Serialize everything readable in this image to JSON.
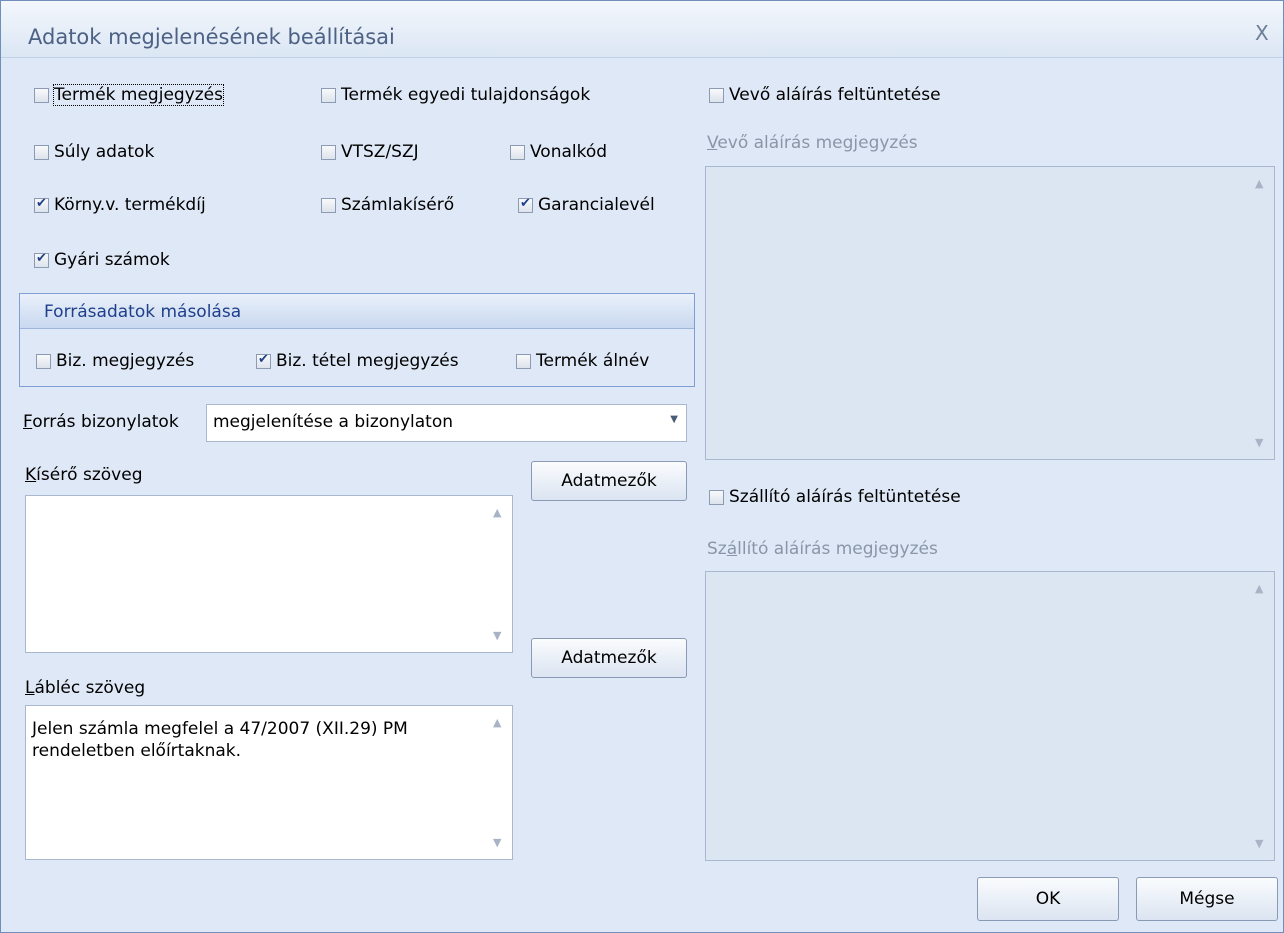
{
  "window": {
    "title": "Adatok megjelenésének beállításai",
    "close_glyph": "X"
  },
  "options": {
    "termek_megjegyzes": {
      "label": "Termék megjegyzés",
      "checked": false
    },
    "termek_egyedi": {
      "label": "Termék egyedi tulajdonságok",
      "checked": false
    },
    "suly_adatok": {
      "label": "Súly adatok",
      "checked": false
    },
    "vtsz": {
      "label": "VTSZ/SZJ",
      "checked": false
    },
    "vonalkod": {
      "label": "Vonalkód",
      "checked": false
    },
    "korny": {
      "label": "Körny.v. termékdíj",
      "checked": true
    },
    "szamlakisero": {
      "label": "Számlakísérő",
      "checked": false
    },
    "garancialevel": {
      "label": "Garancialevél",
      "checked": true
    },
    "gyari_szamok": {
      "label": "Gyári számok",
      "checked": true
    }
  },
  "source_copy": {
    "title": "Forrásadatok másolása",
    "biz_megjegyzes": {
      "label": "Biz. megjegyzés",
      "checked": false
    },
    "biz_tetel": {
      "label": "Biz. tétel megjegyzés",
      "checked": true
    },
    "termek_alnev": {
      "label": "Termék álnév",
      "checked": false
    }
  },
  "source_docs": {
    "label_first": "F",
    "label_rest": "orrás bizonylatok",
    "value": "megjelenítése a bizonylaton"
  },
  "kisero": {
    "label_first": "K",
    "label_rest": "ísérő szöveg",
    "value": "",
    "button": "Adatmezők"
  },
  "lablec": {
    "label_first": "L",
    "label_rest": "ábléc szöveg",
    "line1": "Jelen számla megfelel a 47/2007 (XII.29) PM",
    "line2": "rendeletben előírtaknak.",
    "button": "Adatmezők"
  },
  "vevo": {
    "checkbox": "Vevő aláírás feltüntetése",
    "checked": false,
    "label_first": "V",
    "label_rest": "evő aláírás megjegyzés"
  },
  "szallito": {
    "checkbox": "Szállító aláírás feltüntetése",
    "checked": false,
    "label_first": "Sz",
    "label_mid": "á",
    "label_rest": "llító aláírás megjegyzés"
  },
  "buttons": {
    "ok": "OK",
    "cancel": "Mégse"
  },
  "colors": {
    "background": "#dfe8f6",
    "accent": "#1e3f8a",
    "border": "#7d9fd4"
  }
}
